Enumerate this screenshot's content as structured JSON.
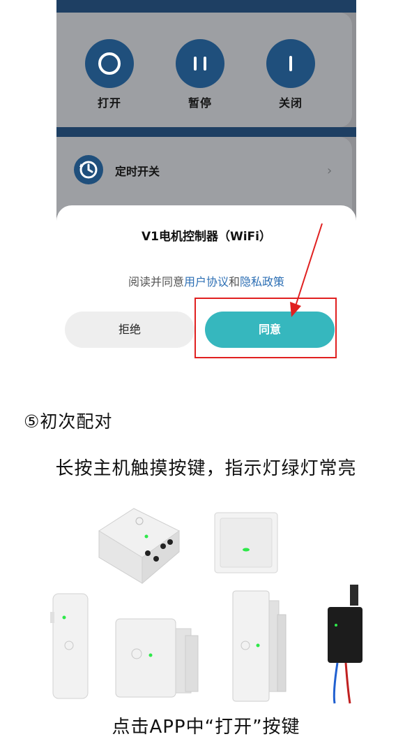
{
  "app": {
    "controls": [
      {
        "label": "打开",
        "icon": "power-ring-icon"
      },
      {
        "label": "暂停",
        "icon": "pause-icon"
      },
      {
        "label": "关闭",
        "icon": "power-off-icon"
      }
    ],
    "timer": {
      "label": "定时开关",
      "icon": "clock-icon",
      "chevron": "›"
    }
  },
  "dialog": {
    "title": "V1电机控制器（WiFi）",
    "agreement_prefix": "阅读并同意",
    "user_agreement": "用户协议",
    "and": "和",
    "privacy_policy": "隐私政策",
    "reject_label": "拒绝",
    "accept_label": "同意"
  },
  "instructions": {
    "step_title": "⑤初次配对",
    "step_desc": "长按主机触摸按键，指示灯绿灯常亮",
    "caption": "点击APP中“打开”按键"
  },
  "colors": {
    "accent": "#36b7be",
    "link": "#2d6fb4",
    "highlight": "#e02020",
    "icon_bg": "#1f4f7c",
    "led": "#2ee84a"
  },
  "devices": [
    {
      "name": "din-rail-module"
    },
    {
      "name": "wall-switch"
    },
    {
      "name": "slim-controller"
    },
    {
      "name": "square-motor"
    },
    {
      "name": "ribbed-controller"
    },
    {
      "name": "black-receiver"
    }
  ]
}
